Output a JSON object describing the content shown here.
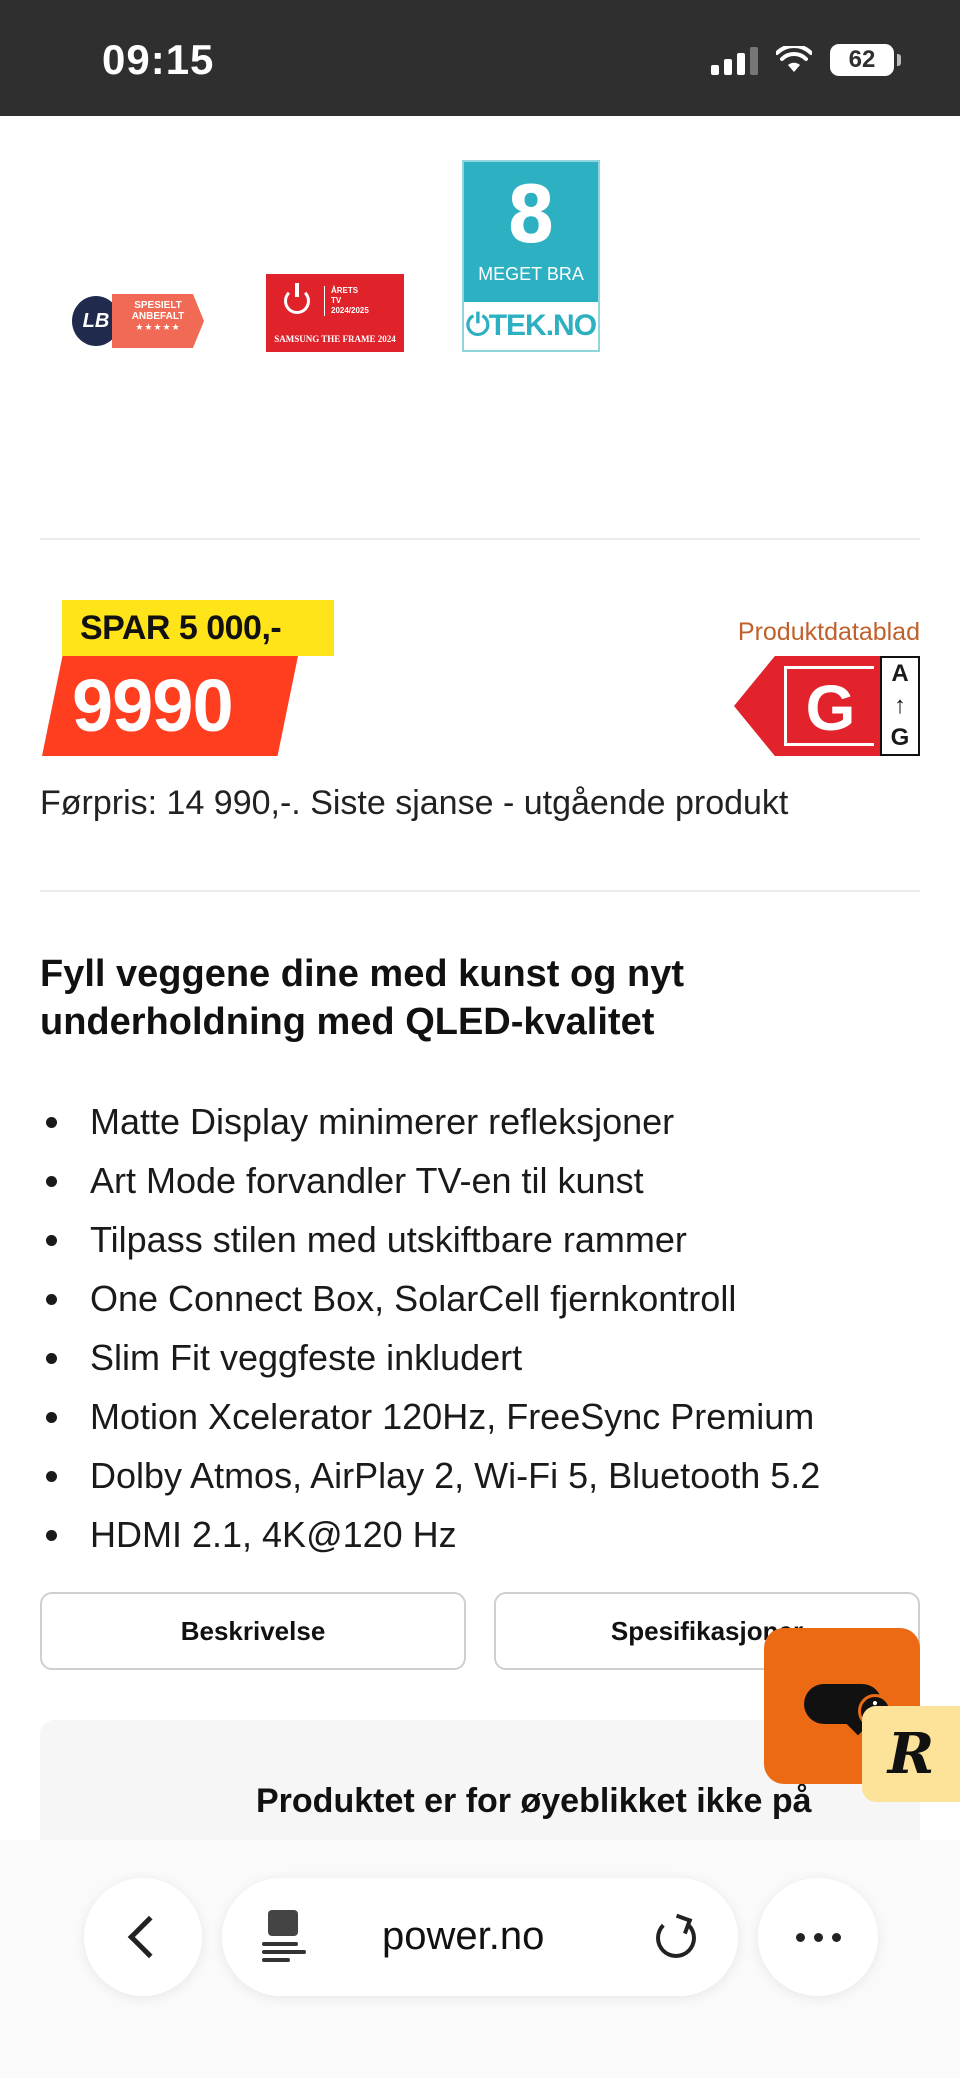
{
  "status_bar": {
    "time": "09:15",
    "battery": "62"
  },
  "awards": {
    "lb": {
      "logo": "LB",
      "line1": "SPESIELT",
      "line2": "ANBEFALT",
      "stars": "★★★★★"
    },
    "arets_tv": {
      "line1": "ÅRETS",
      "line2": "TV",
      "line3": "2024/2025",
      "footer": "SAMSUNG THE FRAME 2024"
    },
    "tek": {
      "score": "8",
      "verdict": "MEGET BRA",
      "brand": "TEK.NO"
    }
  },
  "price": {
    "save_label": "SPAR 5 000,-",
    "current": "9990",
    "datasheet_link": "Produktdatablad",
    "energy_class": "G",
    "energy_scale_top": "A",
    "energy_scale_arrow": "↑",
    "energy_scale_bottom": "G",
    "previous_price_note": "Førpris: 14 990,-. Siste sjanse - utgående produkt"
  },
  "description": {
    "headline": "Fyll veggene dine med kunst og nyt underholdning med QLED-kvalitet",
    "features": [
      "Matte Display minimerer refleksjoner",
      "Art Mode forvandler TV-en til kunst",
      "Tilpass stilen med utskiftbare rammer",
      "One Connect Box, SolarCell fjernkontroll",
      "Slim Fit veggfeste inkludert",
      "Motion Xcelerator 120Hz, FreeSync Premium",
      "Dolby Atmos, AirPlay 2, Wi-Fi 5, Bluetooth 5.2",
      "HDMI 2.1, 4K@120 Hz"
    ]
  },
  "tabs": {
    "description": "Beskrivelse",
    "specifications": "Spesifikasjoner"
  },
  "stock_notice": "Produktet er for øyeblikket ikke på",
  "chat": {
    "info_glyph": "i",
    "reader_glyph": "R"
  },
  "browser": {
    "url": "power.no"
  },
  "colors": {
    "accent_orange": "#ec6a14",
    "price_red": "#ff3d1f",
    "save_yellow": "#ffe419",
    "energy_red": "#e3232b",
    "link_brown": "#c0602a"
  }
}
